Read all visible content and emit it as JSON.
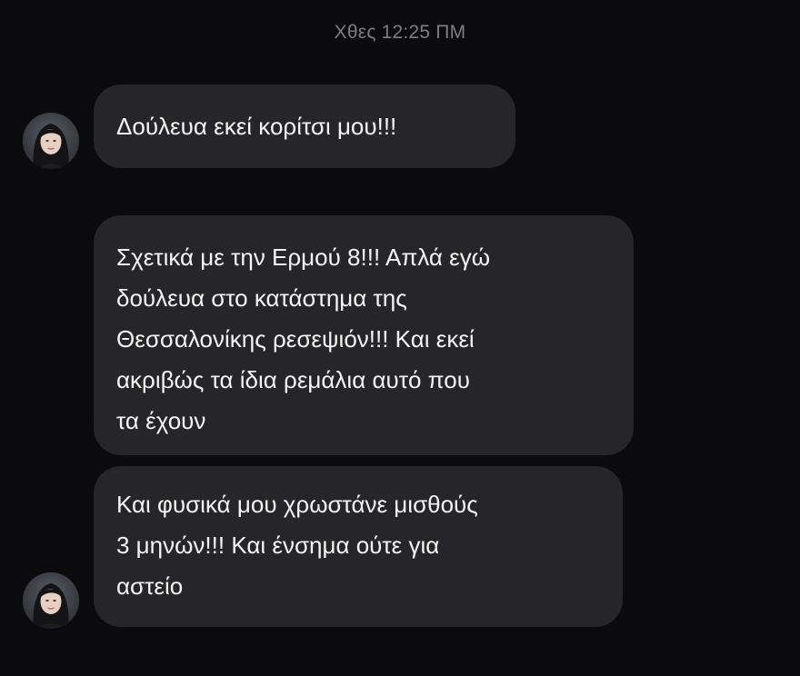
{
  "thread": {
    "timestamp": "Χθες 12:25 ΠΜ"
  },
  "messages": [
    {
      "lines": [
        "Δούλευα εκεί κορίτσι μου!!!"
      ]
    },
    {
      "lines": [
        "Σχετικά με την Ερμού 8!!! Απλά εγώ",
        "δούλευα στο κατάστημα της",
        "Θεσσαλονίκης ρεσεψιόν!!! Και εκεί",
        "ακριβώς τα ίδια ρεμάλια αυτό που",
        "τα έχουν"
      ]
    },
    {
      "lines": [
        "Και φυσικά μου χρωστάνε μισθούς",
        "3 μηνών!!! Και ένσημα ούτε για",
        "αστείο"
      ]
    }
  ],
  "colors": {
    "background": "#0b0b0d",
    "bubble": "#262628",
    "timestamp": "#7d7d82",
    "text": "#f4f4f4"
  },
  "icons": {
    "sender_avatar": "avatar"
  }
}
